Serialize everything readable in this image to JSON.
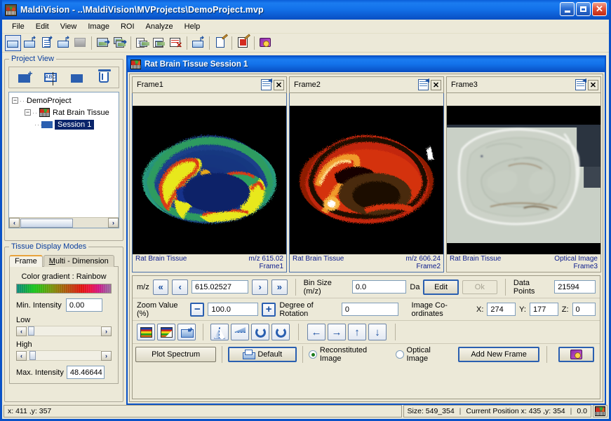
{
  "window": {
    "title": "MaldiVision - ..\\MaldiVision\\MVProjects\\DemoProject.mvp",
    "minimize_label": "_",
    "maximize_label": "□",
    "close_label": "✕"
  },
  "menu": {
    "items": [
      "File",
      "Edit",
      "View",
      "Image",
      "ROI",
      "Analyze",
      "Help"
    ]
  },
  "toolbar": {
    "items": [
      {
        "name": "open-project-icon"
      },
      {
        "name": "save-project-icon"
      },
      {
        "name": "new-document-icon"
      },
      {
        "name": "save-as-icon"
      },
      {
        "name": "image-placeholder-icon"
      },
      {
        "name": "export-image-icon"
      },
      {
        "name": "export-frames-icon"
      },
      {
        "name": "copy-image-icon"
      },
      {
        "name": "paste-image-icon"
      },
      {
        "name": "delete-table-icon"
      },
      {
        "name": "load-folder-icon"
      },
      {
        "name": "document-properties-icon"
      },
      {
        "name": "edit-annotation-icon"
      },
      {
        "name": "help-book-icon"
      }
    ]
  },
  "project_view": {
    "caption": "Project View",
    "tools": [
      {
        "name": "add-spectrum-icon"
      },
      {
        "name": "rename-node-icon"
      },
      {
        "name": "spectrum-group-icon"
      },
      {
        "name": "delete-node-icon"
      }
    ],
    "tree": [
      {
        "label": "DemoProject",
        "expander": "−",
        "level": 0,
        "icon": "none",
        "selected": false
      },
      {
        "label": "Rat Brain Tissue",
        "expander": "−",
        "level": 1,
        "icon": "tissue",
        "selected": false
      },
      {
        "label": "Session 1",
        "expander": "",
        "level": 2,
        "icon": "spectrum",
        "selected": true
      }
    ],
    "scroll_left": "‹",
    "scroll_right": "›"
  },
  "tissue_display": {
    "caption": "Tissue Display Modes",
    "tabs": [
      {
        "label": "Frame",
        "active": true
      },
      {
        "label": "Multi - Dimension",
        "active": false
      }
    ],
    "color_gradient_label": "Color gradient : Rainbow",
    "min_intensity_label": "Min. Intensity",
    "min_intensity_value": "0.00",
    "low_label": "Low",
    "high_label": "High",
    "max_intensity_label": "Max. Intensity",
    "max_intensity_value": "48.46644",
    "slider_left": "‹",
    "slider_right": "›"
  },
  "mdi": {
    "title": "Rat Brain Tissue Session 1"
  },
  "frames": [
    {
      "tab_label": "Frame1",
      "tissue_name": "Rat Brain Tissue",
      "mz_label": "m/z 615.02",
      "frame_label": "Frame1",
      "colormap": "rainbow"
    },
    {
      "tab_label": "Frame2",
      "tissue_name": "Rat Brain Tissue",
      "mz_label": "m/z 606.24",
      "frame_label": "Frame2",
      "colormap": "hot"
    },
    {
      "tab_label": "Frame3",
      "tissue_name": "Rat Brain Tissue",
      "mz_label": "Optical Image",
      "frame_label": "Frame3",
      "colormap": "optical"
    }
  ],
  "controls": {
    "mz_label": "m/z",
    "mz_first": "«",
    "mz_prev": "‹",
    "mz_value": "615.02527",
    "mz_next": "›",
    "mz_last": "»",
    "bin_size_label": "Bin Size (m/z)",
    "bin_size_value": "0.0",
    "da_label": "Da",
    "edit_label": "Edit",
    "ok_label": "Ok",
    "data_points_label": "Data Points",
    "data_points_value": "21594",
    "zoom_label": "Zoom Value (%)",
    "zoom_minus": "−",
    "zoom_value": "100.0",
    "zoom_plus": "+",
    "rotation_label": "Degree of Rotation",
    "rotation_value": "0",
    "coords_label": "Image Co-ordinates",
    "coord_x_label": "X:",
    "coord_x_value": "274",
    "coord_y_label": "Y:",
    "coord_y_value": "177",
    "coord_z_label": "Z:",
    "coord_z_value": "0",
    "image_tools": [
      {
        "name": "color-palette-icon"
      },
      {
        "name": "palette-overlay-icon"
      },
      {
        "name": "export-view-icon"
      }
    ],
    "transform_tools": [
      {
        "name": "flip-horizontal-icon"
      },
      {
        "name": "flip-vertical-icon"
      },
      {
        "name": "rotate-counterclockwise-icon"
      },
      {
        "name": "rotate-clockwise-icon"
      }
    ],
    "pan_tools": [
      {
        "name": "pan-left-icon",
        "glyph": "←"
      },
      {
        "name": "pan-right-icon",
        "glyph": "→"
      },
      {
        "name": "pan-up-icon",
        "glyph": "↑"
      },
      {
        "name": "pan-down-icon",
        "glyph": "↓"
      }
    ],
    "plot_spectrum_label": "Plot Spectrum",
    "default_label": "Default",
    "reconstituted_label": "Reconstituted Image",
    "optical_label": "Optical Image",
    "selected_image_mode": "Reconstituted Image",
    "add_new_frame_label": "Add New Frame",
    "help_button_name": "help-book-button"
  },
  "status": {
    "cursor": "x: 411 ,y: 357",
    "size_label": "Size: 549_354",
    "position_label": "Current Position x: 435 ,y: 354",
    "value_label": "0.0"
  }
}
